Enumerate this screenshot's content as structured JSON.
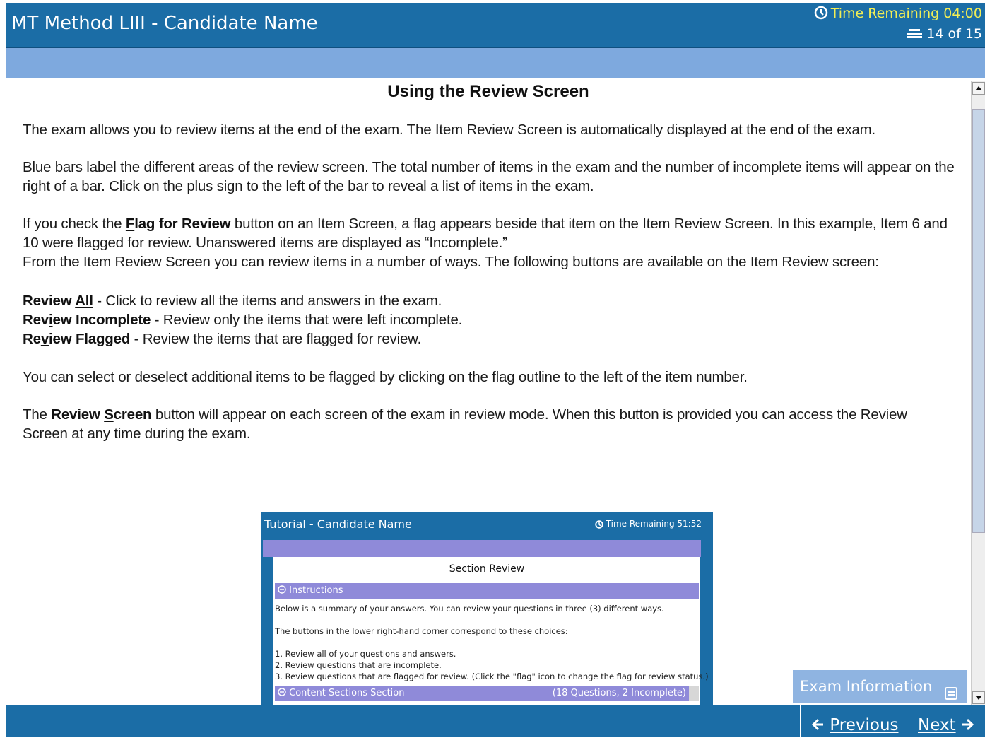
{
  "header": {
    "title": "MT Method LIII - Candidate Name",
    "timer": "Time Remaining 04:00",
    "progress": "14 of 15"
  },
  "content": {
    "heading": "Using the Review Screen",
    "p1": "The exam allows you to review items at the end of the exam. The Item Review Screen is automatically displayed at the end of the exam.",
    "p2": "Blue bars label the different areas of the review screen. The total number of items in the exam and the number of incomplete items will appear on the right of a bar. Click on the plus sign to the left of the bar to reveal a list of items in the exam.",
    "p3_before": "If you check the ",
    "p3_flag_underlined": "F",
    "p3_flag_rest": "lag for Review",
    "p3_after": " button on an Item Screen, a flag appears beside that item on the Item Review Screen. In this example, Item 6 and 10 were flagged for review. Unanswered items are displayed as “Incomplete.”",
    "p4": "From the Item Review Screen you can review items in a number of ways. The following buttons are available on the Item Review screen:",
    "review_all_a": "Review ",
    "review_all_b": "All",
    "review_all_desc": " - Click to review all the items and answers in the exam.",
    "review_incomplete_a": "Rev",
    "review_incomplete_b": "i",
    "review_incomplete_c": "ew Incomplete",
    "review_incomplete_desc": " - Review only the items that were left incomplete.",
    "review_flagged_a": "Re",
    "review_flagged_b": "v",
    "review_flagged_c": "iew Flagged",
    "review_flagged_desc": " - Review the items that are flagged for review.",
    "p5": "You can select or deselect additional items to be flagged by clicking on the flag outline to the left of the item number.",
    "p6_before": "The ",
    "p6_bold_a": "Review ",
    "p6_bold_u": "S",
    "p6_bold_b": "creen",
    "p6_after": " button will appear on each screen of the exam in review mode. When this button is provided you can access the Review Screen at any time during the exam."
  },
  "example": {
    "title": "Tutorial - Candidate Name",
    "timer": "Time Remaining 51:52",
    "heading": "Section Review",
    "instructions_bar": "Instructions",
    "line1": "Below is a summary of your answers. You can review your questions in three (3) different ways.",
    "line2": "The buttons in the lower right-hand corner correspond to these choices:",
    "line3": "1. Review all of your questions and answers.",
    "line4": "2. Review questions that are incomplete.",
    "line5": "3. Review questions that are flagged for review. (Click the \"flag\" icon to change the flag for review status.)",
    "section_bar": "Content Sections Section",
    "section_count": "(18 Questions, 2 Incomplete)"
  },
  "exam_info": {
    "label": "Exam Information"
  },
  "footer": {
    "previous": "Previous",
    "next": "Next"
  },
  "colors": {
    "header": "#1b6da6",
    "subbar": "#7ea9de",
    "timer": "#f2ee55",
    "example_bar": "#8f8ad9",
    "exam_info_bg": "#8fb4e1"
  },
  "icons": {
    "timer": "clock-icon",
    "progress": "stack-icon",
    "previous": "arrow-left-icon",
    "next": "arrow-right-icon",
    "exam_info": "window-icon",
    "bar_toggle": "collapse-minus-icon"
  }
}
